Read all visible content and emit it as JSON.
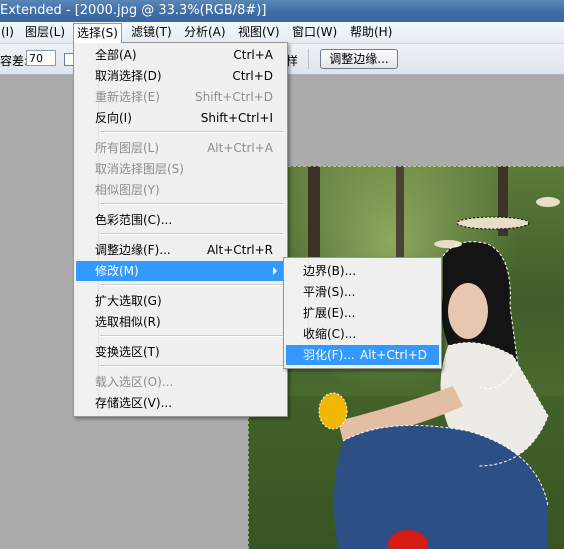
{
  "window": {
    "title": "Extended - [2000.jpg @ 33.3%(RGB/8#)]"
  },
  "menubar": {
    "items": [
      {
        "label": "(I)"
      },
      {
        "label": "图层(L)"
      },
      {
        "label": "选择(S)"
      },
      {
        "label": "滤镜(T)"
      },
      {
        "label": "分析(A)"
      },
      {
        "label": "视图(V)"
      },
      {
        "label": "窗口(W)"
      },
      {
        "label": "帮助(H)"
      }
    ]
  },
  "options": {
    "tolerance_label": "容差:",
    "tolerance_value": "70",
    "tail_label": "样",
    "refine_button": "调整边缘..."
  },
  "select_menu": {
    "items": [
      {
        "label": "全部(A)",
        "shortcut": "Ctrl+A"
      },
      {
        "label": "取消选择(D)",
        "shortcut": "Ctrl+D"
      },
      {
        "label": "重新选择(E)",
        "shortcut": "Shift+Ctrl+D"
      },
      {
        "label": "反向(I)",
        "shortcut": "Shift+Ctrl+I"
      },
      {
        "label": "所有图层(L)",
        "shortcut": "Alt+Ctrl+A"
      },
      {
        "label": "取消选择图层(S)",
        "shortcut": ""
      },
      {
        "label": "相似图层(Y)",
        "shortcut": ""
      },
      {
        "label": "色彩范围(C)...",
        "shortcut": ""
      },
      {
        "label": "调整边缘(F)...",
        "shortcut": "Alt+Ctrl+R"
      },
      {
        "label": "修改(M)",
        "shortcut": ""
      },
      {
        "label": "扩大选取(G)",
        "shortcut": ""
      },
      {
        "label": "选取相似(R)",
        "shortcut": ""
      },
      {
        "label": "变换选区(T)",
        "shortcut": ""
      },
      {
        "label": "载入选区(O)...",
        "shortcut": ""
      },
      {
        "label": "存储选区(V)...",
        "shortcut": ""
      }
    ]
  },
  "modify_submenu": {
    "items": [
      {
        "label": "边界(B)...",
        "shortcut": ""
      },
      {
        "label": "平滑(S)...",
        "shortcut": ""
      },
      {
        "label": "扩展(E)...",
        "shortcut": ""
      },
      {
        "label": "收缩(C)...",
        "shortcut": ""
      },
      {
        "label": "羽化(F)...",
        "shortcut": "Alt+Ctrl+D"
      }
    ]
  },
  "colors": {
    "highlight": "#3399ff",
    "title_bar": "#3f6ea6",
    "workspace": "#ababab"
  }
}
